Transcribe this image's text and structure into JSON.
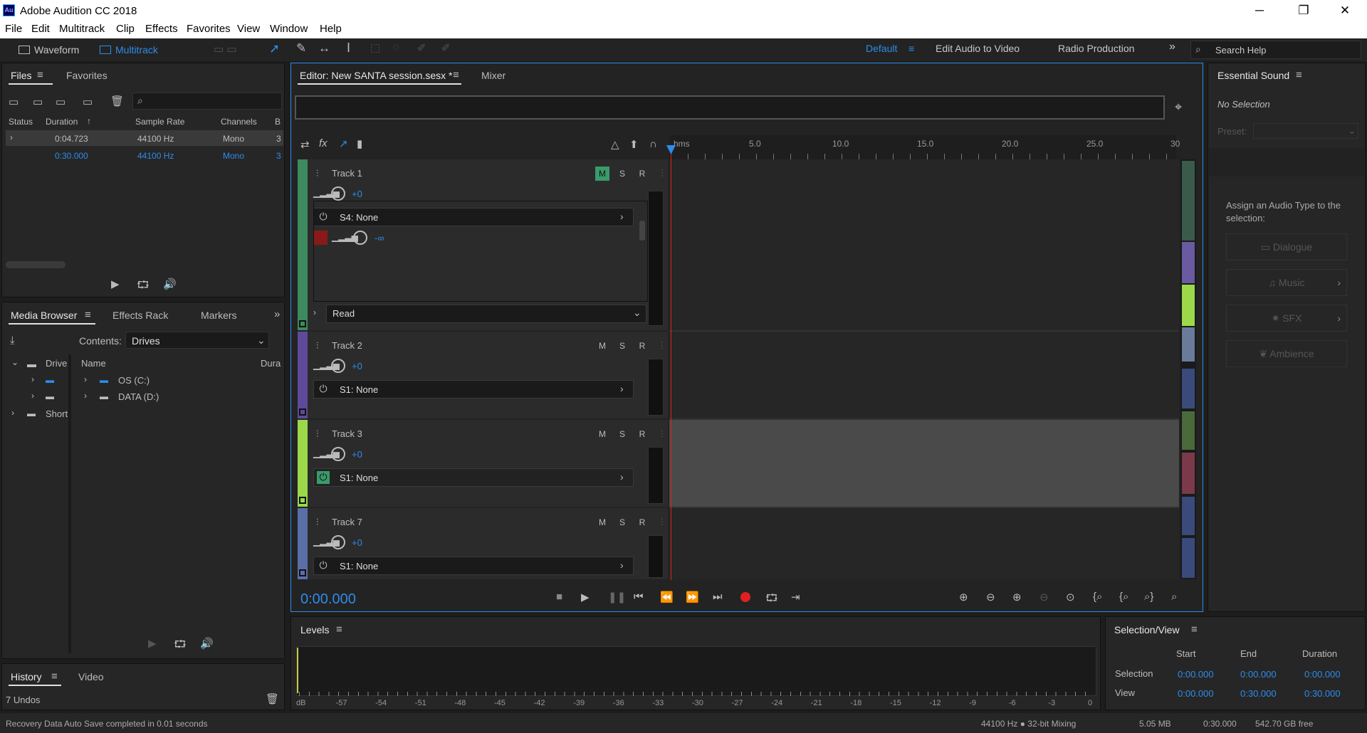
{
  "window": {
    "title": "Adobe Audition CC 2018",
    "icon_text": "Au",
    "minimize": "─",
    "maximize": "❐",
    "close": "✕"
  },
  "menu": [
    "File",
    "Edit",
    "Multitrack",
    "Clip",
    "Effects",
    "Favorites",
    "View",
    "Window",
    "Help"
  ],
  "toolbar": {
    "waveform": "Waveform",
    "multitrack": "Multitrack",
    "workspaces": [
      "Default",
      "Edit Audio to Video",
      "Radio Production"
    ],
    "more": "»",
    "search_placeholder": "Search Help"
  },
  "files": {
    "tabs": [
      "Files",
      "Favorites"
    ],
    "columns": [
      "Status",
      "Duration",
      "Sample Rate",
      "Channels",
      "B"
    ],
    "rows": [
      {
        "duration": "0:04.723",
        "rate": "44100 Hz",
        "channels": "Mono",
        "b": "3"
      },
      {
        "duration": "0:30.000",
        "rate": "44100 Hz",
        "channels": "Mono",
        "b": "3"
      }
    ]
  },
  "media": {
    "tabs": [
      "Media Browser",
      "Effects Rack",
      "Markers"
    ],
    "contents_label": "Contents:",
    "contents_value": "Drives",
    "tree": [
      "Drive",
      "Short"
    ],
    "col_name": "Name",
    "col_dur": "Dura",
    "items": [
      "OS (C:)",
      "DATA (D:)"
    ]
  },
  "history": {
    "tabs": [
      "History",
      "Video"
    ],
    "undos": "7 Undos"
  },
  "status": {
    "left": "Recovery Data Auto Save completed in 0.01 seconds",
    "rate": "44100 Hz ● 32-bit Mixing",
    "size": "5.05 MB",
    "duration": "0:30.000",
    "free": "542.70 GB free"
  },
  "editor": {
    "tab": "Editor: New SANTA session.sesx *",
    "mixer": "Mixer",
    "ruler_unit": "hms",
    "ruler": [
      "5.0",
      "10.0",
      "15.0",
      "20.0",
      "25.0",
      "30"
    ],
    "time": "0:00.000"
  },
  "tracks": [
    {
      "name": "Track 1",
      "vol": "+0",
      "send": "S4: None",
      "send_vol": "-∞",
      "auto": "Read",
      "color": "#3d8a5e"
    },
    {
      "name": "Track 2",
      "vol": "+0",
      "send": "S1: None",
      "color": "#5d4a9a"
    },
    {
      "name": "Track 3",
      "vol": "+0",
      "send": "S1: None",
      "color": "#9bd94a"
    },
    {
      "name": "Track 7",
      "vol": "+0",
      "send": "S1: None",
      "color": "#5a6fa8"
    }
  ],
  "track_btns": [
    "M",
    "S",
    "R"
  ],
  "essential": {
    "title": "Essential Sound",
    "no_sel": "No Selection",
    "preset": "Preset:",
    "assign": "Assign an Audio Type to the selection:",
    "types": [
      "Dialogue",
      "Music",
      "SFX",
      "Ambience"
    ]
  },
  "levels": {
    "title": "Levels",
    "scale": [
      "dB",
      "-57",
      "-54",
      "-51",
      "-48",
      "-45",
      "-42",
      "-39",
      "-36",
      "-33",
      "-30",
      "-27",
      "-24",
      "-21",
      "-18",
      "-15",
      "-12",
      "-9",
      "-6",
      "-3",
      "0"
    ]
  },
  "selview": {
    "title": "Selection/View",
    "cols": [
      "Start",
      "End",
      "Duration"
    ],
    "rows": [
      {
        "label": "Selection",
        "v": [
          "0:00.000",
          "0:00.000",
          "0:00.000"
        ]
      },
      {
        "label": "View",
        "v": [
          "0:00.000",
          "0:30.000",
          "0:30.000"
        ]
      }
    ]
  }
}
